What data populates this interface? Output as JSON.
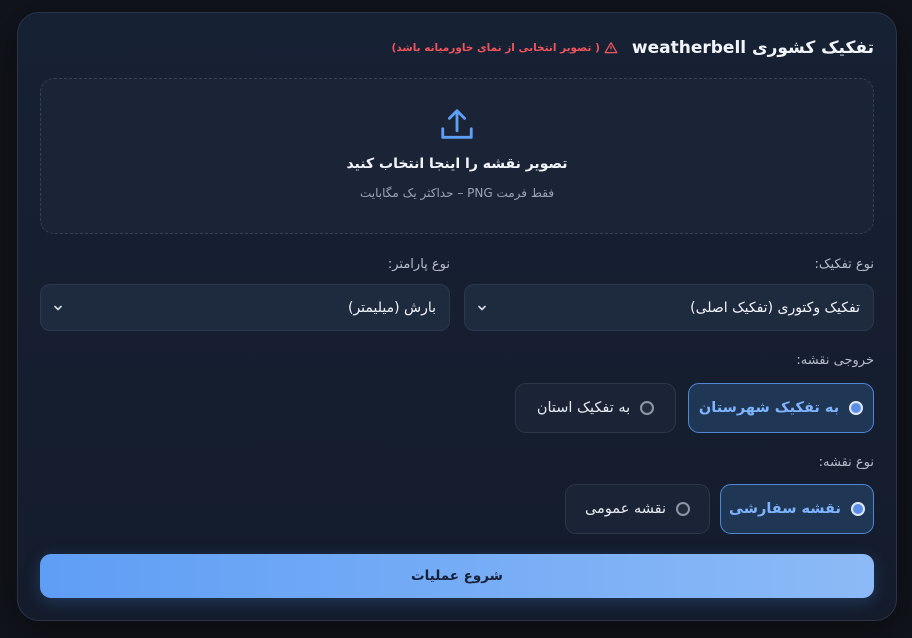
{
  "header": {
    "title": "تفکیک کشوری weatherbell",
    "warning": "( تصویر انتخابی از نمای خاورمیانه باشد)",
    "warning_icon": "warning-triangle-icon"
  },
  "dropzone": {
    "icon": "upload-icon",
    "title": "تصویر نقشه را اینجا انتخاب کنید",
    "subtitle": "فقط فرمت PNG – حداکثر یک مگابایت"
  },
  "separation_type": {
    "label": "نوع تفکیک:",
    "value": "تفکیک وکتوری (تفکیک اصلی)"
  },
  "parameter_type": {
    "label": "نوع پارامتر:",
    "value": "بارش (میلیمتر)"
  },
  "map_output": {
    "label": "خروجی نقشه:",
    "options": [
      {
        "label": "به تفکیک شهرستان",
        "selected": true
      },
      {
        "label": "به تفکیک استان",
        "selected": false
      }
    ]
  },
  "map_type": {
    "label": "نوع نقشه:",
    "options": [
      {
        "label": "نقشه سفارشی",
        "selected": true
      },
      {
        "label": "نقشه عمومی",
        "selected": false
      }
    ]
  },
  "start_button": {
    "label": "شروع عملیات"
  },
  "colors": {
    "accent": "#5f9ef5",
    "warning": "#f0545c",
    "card_bg": "#172134"
  }
}
